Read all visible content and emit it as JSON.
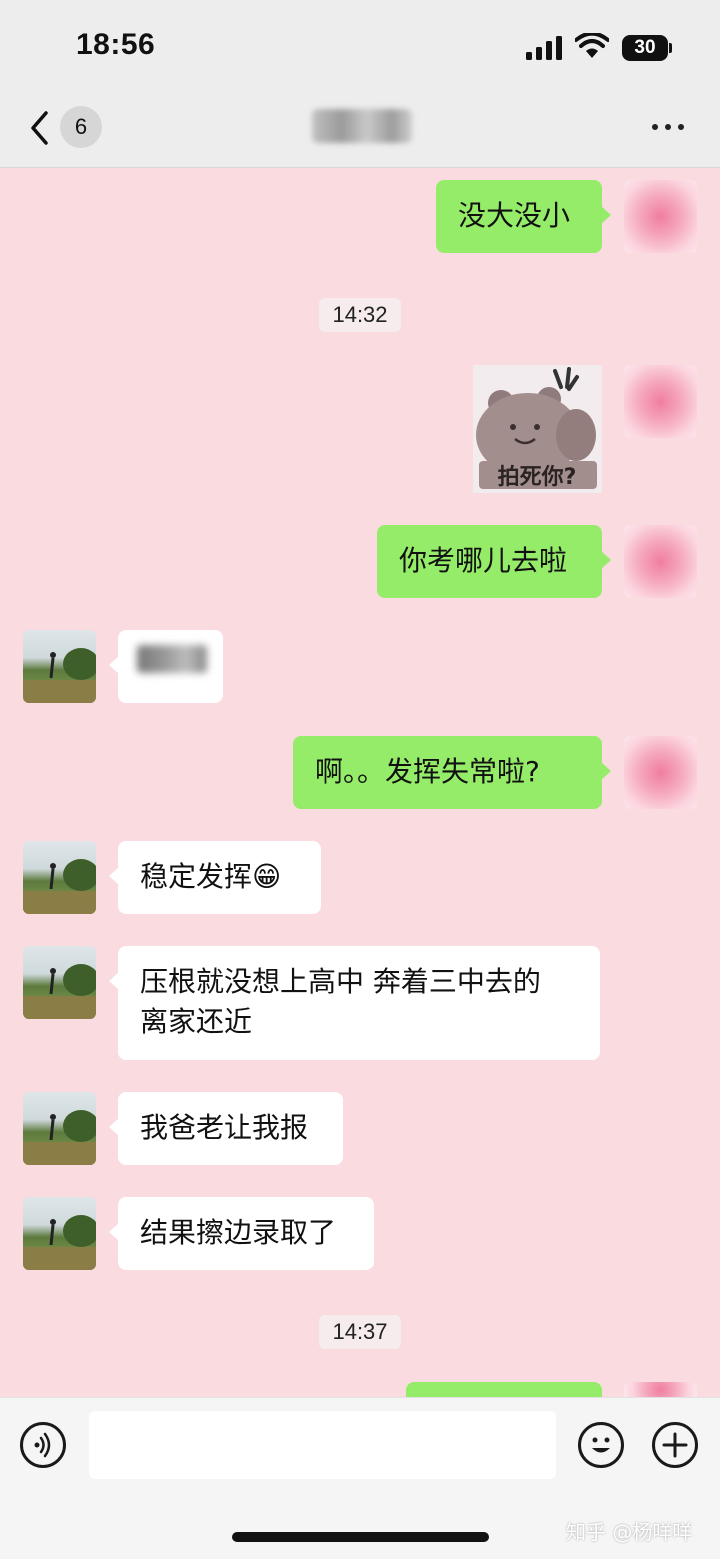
{
  "status_bar": {
    "time": "18:56",
    "battery_level": "30"
  },
  "nav": {
    "unread_count": "6",
    "chat_title_obscured": true
  },
  "messages": [
    {
      "side": "out",
      "text": "没大没小"
    },
    {
      "type": "timestamp",
      "text": "14:32"
    },
    {
      "side": "out",
      "type": "sticker",
      "sticker_text": "拍死你?"
    },
    {
      "side": "out",
      "text": "你考哪儿去啦"
    },
    {
      "side": "in",
      "text_obscured": true
    },
    {
      "side": "out",
      "text": "啊。。发挥失常啦?"
    },
    {
      "side": "in",
      "text": "稳定发挥😁"
    },
    {
      "side": "in",
      "lines": [
        "压根就没想上高中 奔着三中去的",
        "离家还近"
      ]
    },
    {
      "side": "in",
      "text": "我爸老让我报"
    },
    {
      "side": "in",
      "text": "结果擦边录取了"
    },
    {
      "type": "timestamp",
      "text": "14:37"
    }
  ],
  "watermark": "知乎 @杨咩咩",
  "colors": {
    "background": "#fadbe0",
    "outgoing_bubble": "#95ec69",
    "incoming_bubble": "#ffffff",
    "bar": "#ededed"
  }
}
